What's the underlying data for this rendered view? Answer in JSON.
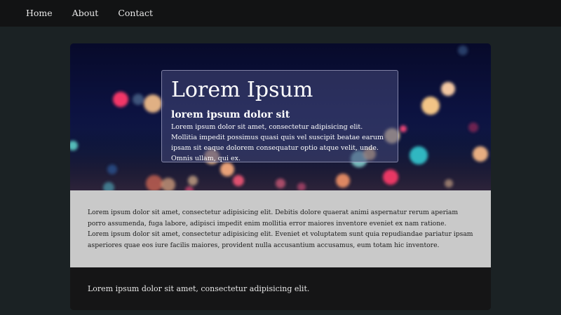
{
  "nav": {
    "items": [
      "Home",
      "About",
      "Contact"
    ]
  },
  "hero": {
    "title": "Lorem Ipsum",
    "subtitle": "lorem ipsum dolor sit",
    "text": "Lorem ipsum dolor sit amet, consectetur adipisicing elit. Mollitia impedit possimus quasi quis vel suscipit beatae earum ipsam sit eaque dolorem consequatur optio atque velit, unde. Omnis ullam, qui ex."
  },
  "content": {
    "paragraph1": "Lorem ipsum dolor sit amet, consectetur adipisicing elit. Debitis dolore quaerat animi aspernatur rerum aperiam porro assumenda, fuga labore, adipisci impedit enim mollitia error maiores inventore eveniet ex nam ratione.",
    "paragraph2": "Lorem ipsum dolor sit amet, consectetur adipisicing elit. Eveniet et voluptatem sunt quia repudiandae pariatur ipsam asperiores quae eos iure facilis maiores, provident nulla accusantium accusamus, eum totam hic inventore."
  },
  "footer": {
    "text": "Lorem ipsum dolor sit amet, consectetur adipisicing elit."
  },
  "colors": {
    "nav_bg": "#121314",
    "page_bg": "#1b2224",
    "content_bg": "#c9c9c9",
    "footer_bg": "#151516"
  }
}
